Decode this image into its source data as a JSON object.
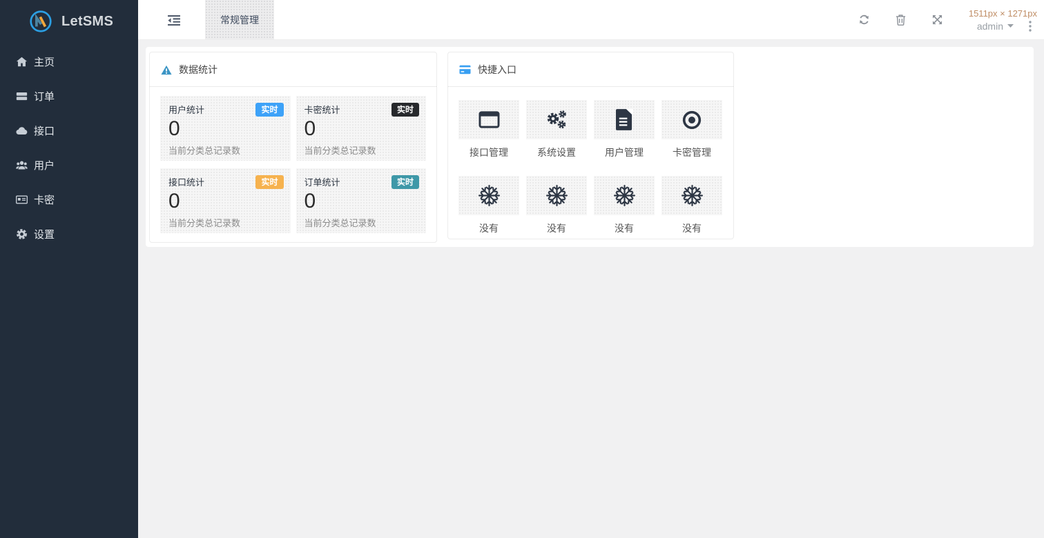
{
  "brand": {
    "name": "LetSMS"
  },
  "sidebar": {
    "items": [
      {
        "label": "主页",
        "icon": "home-icon"
      },
      {
        "label": "订单",
        "icon": "server-icon"
      },
      {
        "label": "接口",
        "icon": "cloud-icon"
      },
      {
        "label": "用户",
        "icon": "users-icon"
      },
      {
        "label": "卡密",
        "icon": "id-card-icon"
      },
      {
        "label": "设置",
        "icon": "gear-icon"
      }
    ]
  },
  "topbar": {
    "tab": "常规管理",
    "viewport_size": "1511px × 1271px",
    "user": "admin"
  },
  "stats_card": {
    "title": "数据统计",
    "items": [
      {
        "label": "用户统计",
        "badge": "实时",
        "badge_color": "#3da2f8",
        "value": "0",
        "subtitle": "当前分类总记录数"
      },
      {
        "label": "卡密统计",
        "badge": "实时",
        "badge_color": "#27292c",
        "value": "0",
        "subtitle": "当前分类总记录数"
      },
      {
        "label": "接口统计",
        "badge": "实时",
        "badge_color": "#f6b24e",
        "value": "0",
        "subtitle": "当前分类总记录数"
      },
      {
        "label": "订单统计",
        "badge": "实时",
        "badge_color": "#3e98a8",
        "value": "0",
        "subtitle": "当前分类总记录数"
      }
    ]
  },
  "quick_card": {
    "title": "快捷入口",
    "tiles": [
      {
        "label": "接口管理",
        "icon": "window-icon"
      },
      {
        "label": "系统设置",
        "icon": "cogs-icon"
      },
      {
        "label": "用户管理",
        "icon": "file-icon"
      },
      {
        "label": "卡密管理",
        "icon": "dot-circle-icon"
      },
      {
        "label": "没有",
        "icon": "snowflake-icon"
      },
      {
        "label": "没有",
        "icon": "snowflake-icon"
      },
      {
        "label": "没有",
        "icon": "snowflake-icon"
      },
      {
        "label": "没有",
        "icon": "snowflake-icon"
      }
    ]
  },
  "colors": {
    "sidebar_bg": "#222d3b",
    "accent_blue": "#3da2f8",
    "badge_dark": "#27292c",
    "badge_orange": "#f6b24e",
    "badge_teal": "#3e98a8",
    "stats_header_icon": "#3c95c5",
    "quick_header_icon": "#389ff2",
    "viewport_text": "#c08e66"
  }
}
